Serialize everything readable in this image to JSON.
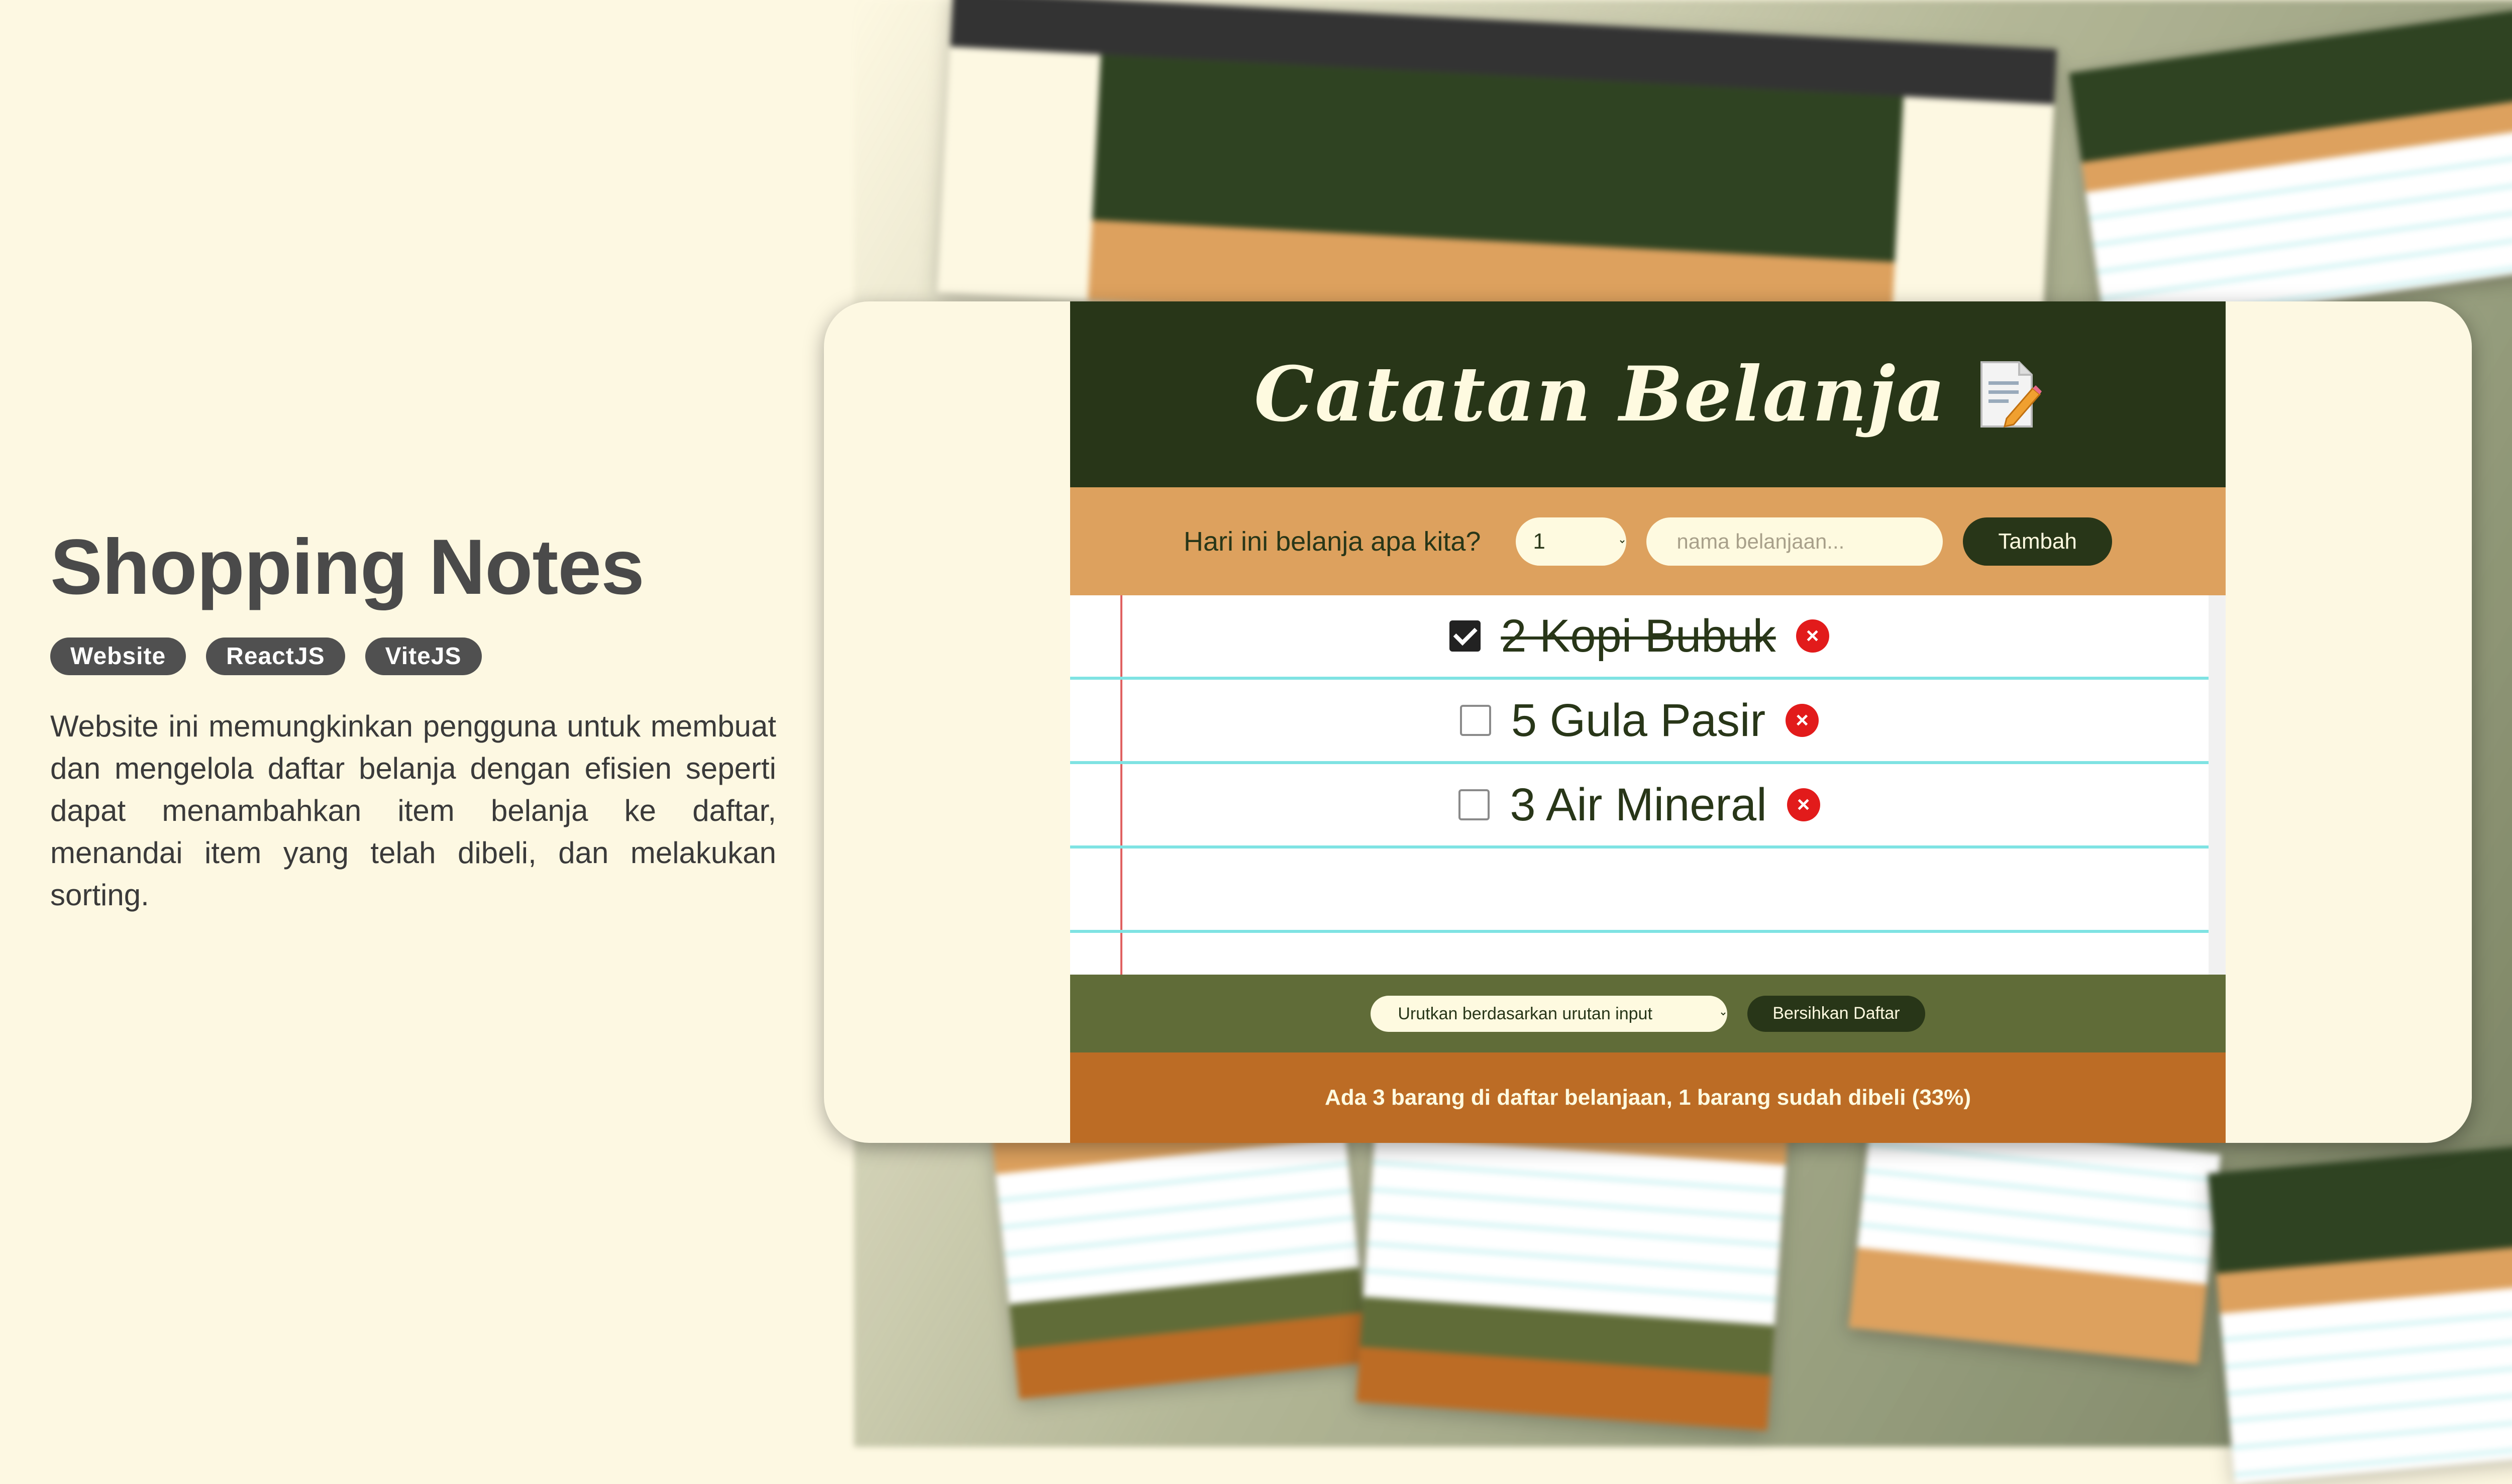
{
  "info": {
    "title": "Shopping Notes",
    "tags": [
      "Website",
      "ReactJS",
      "ViteJS"
    ],
    "description": "Website ini memungkinkan pengguna untuk membuat dan mengelola daftar belanja dengan efisien seperti dapat menambahkan item belanja ke daftar, menandai item yang telah dibeli, dan melakukan sorting."
  },
  "app": {
    "title": "Catatan Belanja",
    "title_icon": "memo-icon",
    "form": {
      "question": "Hari ini belanja apa kita?",
      "quantity_value": "1",
      "name_placeholder": "nama belanjaan...",
      "add_label": "Tambah"
    },
    "items": [
      {
        "label": "2 Kopi Bubuk",
        "checked": true
      },
      {
        "label": "5 Gula Pasir",
        "checked": false
      },
      {
        "label": "3 Air Mineral",
        "checked": false
      }
    ],
    "actions": {
      "sort_label": "Urutkan berdasarkan urutan input",
      "clear_label": "Bersihkan Daftar"
    },
    "stats": "Ada 3 barang di daftar belanjaan, 1 barang sudah dibeli (33%)"
  },
  "colors": {
    "header": "#283618",
    "form_bar": "#dda15e",
    "action_bar": "#606c38",
    "stats_bar": "#bc6c25",
    "delete": "#e21b1b",
    "paper_line": "#7fe3e3",
    "background": "#fdf8e2"
  }
}
